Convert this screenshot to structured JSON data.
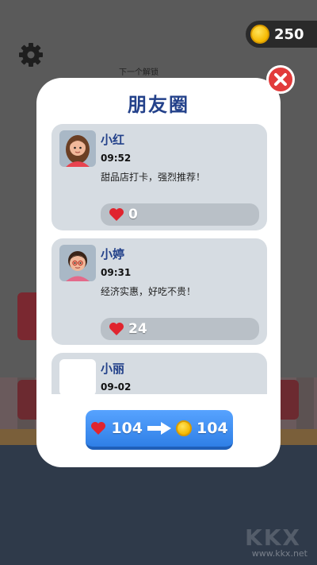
{
  "hud": {
    "coins": "250",
    "next_unlock_label": "下一个解锁"
  },
  "modal": {
    "title": "朋友圈"
  },
  "posts": [
    {
      "name": "小红",
      "time": "09:52",
      "text": "甜品店打卡，强烈推荐！",
      "likes": "0"
    },
    {
      "name": "小婷",
      "time": "09:31",
      "text": "经济实惠，好吃不贵！",
      "likes": "24"
    },
    {
      "name": "小丽",
      "time": "09-02",
      "text": "",
      "likes": ""
    }
  ],
  "convert": {
    "hearts": "104",
    "coins": "104"
  },
  "watermark": "www.kkx.net",
  "colors": {
    "title": "#23418a",
    "heart": "#e0242e",
    "button": "#3a8cf0",
    "close": "#e23b3b"
  }
}
